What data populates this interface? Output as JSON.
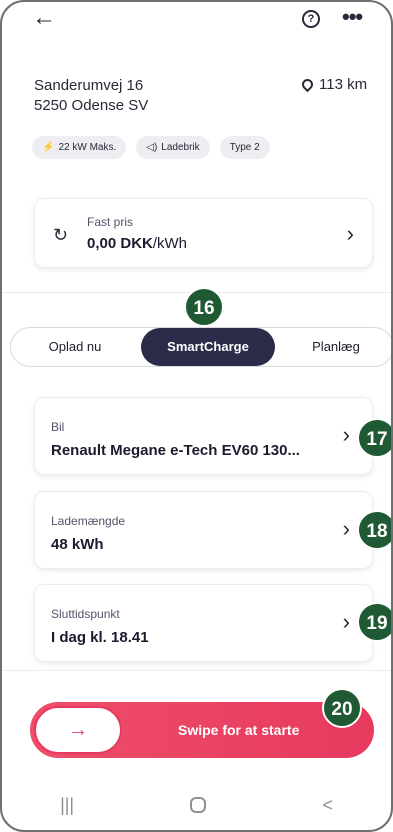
{
  "header": {
    "back_icon": "←",
    "help_icon": "?",
    "more_icon": "•••"
  },
  "location": {
    "street": "Sanderumvej 16",
    "city": "5250 Odense SV",
    "distance": "113 km"
  },
  "tags": [
    {
      "icon": "⚡",
      "label": "22 kW Maks."
    },
    {
      "icon": "◁)",
      "label": "Ladebrik"
    },
    {
      "icon": "",
      "label": "Type 2"
    }
  ],
  "price": {
    "icon": "↻",
    "label": "Fast pris",
    "value": "0,00 DKK",
    "unit": "/kWh"
  },
  "segments": {
    "option1": "Oplad nu",
    "option2": "SmartCharge",
    "option3": "Planlæg"
  },
  "rows": [
    {
      "label": "Bil",
      "value": "Renault Megane e-Tech EV60 130..."
    },
    {
      "label": "Lademængde",
      "value": "48 kWh"
    },
    {
      "label": "Sluttidspunkt",
      "value": "I dag kl. 18.41"
    }
  ],
  "swipe": {
    "arrow": "→",
    "label": "Swipe for at starte"
  },
  "badges": [
    "16",
    "17",
    "18",
    "19",
    "20"
  ],
  "nav": {
    "recent": "|||",
    "back": "<"
  },
  "colors": {
    "accent": "#e63a5e",
    "segment_active": "#2b2b4a",
    "badge": "#1f5a34"
  }
}
